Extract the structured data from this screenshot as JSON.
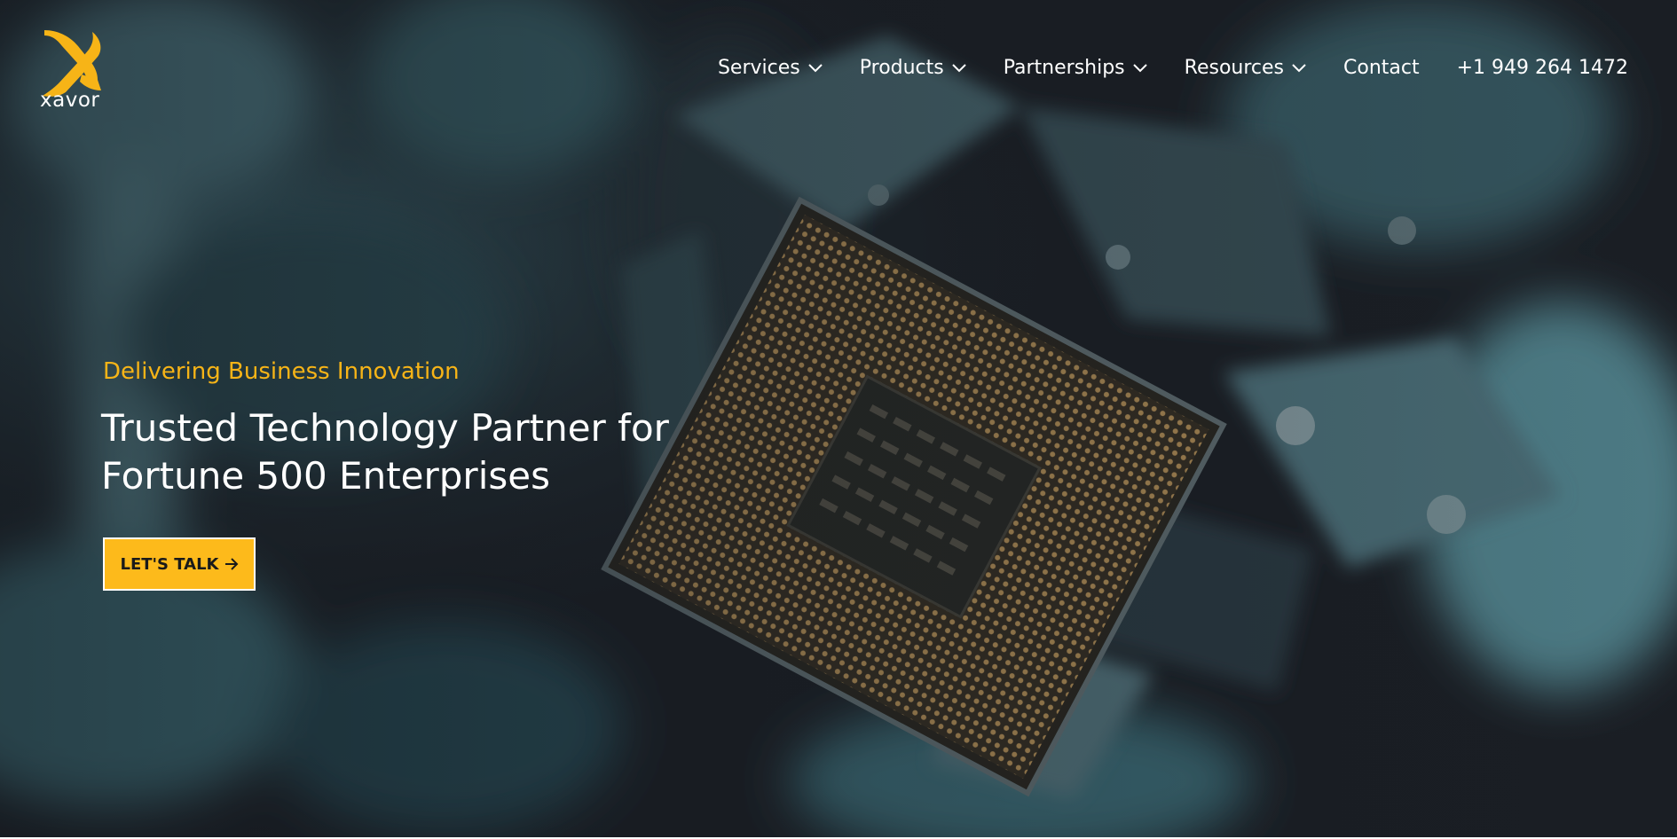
{
  "brand": {
    "name": "xavor",
    "accent_color": "#f7b417",
    "logo_icon": "x-mark-logo-icon"
  },
  "nav": {
    "items": [
      {
        "label": "Services",
        "has_dropdown": true
      },
      {
        "label": "Products",
        "has_dropdown": true
      },
      {
        "label": "Partnerships",
        "has_dropdown": true
      },
      {
        "label": "Resources",
        "has_dropdown": true
      },
      {
        "label": "Contact",
        "has_dropdown": false
      },
      {
        "label": "+1 949 264 1472",
        "has_dropdown": false
      }
    ],
    "dropdown_icon": "chevron-down-icon"
  },
  "hero": {
    "eyebrow": "Delivering Business Innovation",
    "headline_line1": "Trusted Technology Partner for",
    "headline_line2": "Fortune 500 Enterprises",
    "cta_label": "LET'S TALK",
    "cta_icon": "arrow-right-icon",
    "cta_color": "#fdba1b",
    "background_image": "cpu-chip-in-robotic-holder-photo"
  }
}
